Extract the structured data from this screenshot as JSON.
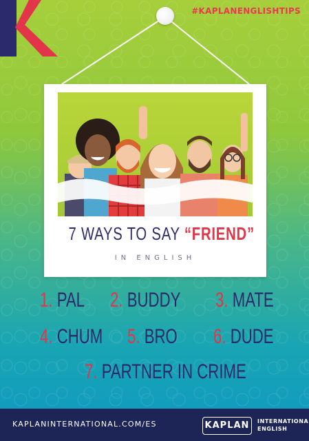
{
  "hashtag": "#KAPLANENGLISHTIPS",
  "title": {
    "prefix": "7 WAYS TO SAY ",
    "highlight": "“FRIEND”",
    "subtitle": "IN ENGLISH"
  },
  "list": [
    {
      "num": "1.",
      "word": "PAL"
    },
    {
      "num": "2.",
      "word": "BUDDY"
    },
    {
      "num": "3.",
      "word": "MATE"
    },
    {
      "num": "4.",
      "word": "CHUM"
    },
    {
      "num": "5.",
      "word": "BRO"
    },
    {
      "num": "6.",
      "word": "DUDE"
    },
    {
      "num": "7.",
      "word": "PARTNER IN CRIME"
    }
  ],
  "footer": {
    "url": "KAPLANINTERNATIONAL.COM/ES",
    "brand": "KAPLAN",
    "brand_sub_1": "INTERNATIONAL",
    "brand_sub_2": "ENGLISH"
  },
  "colors": {
    "accent_red": "#e2354a",
    "navy": "#2c2a6a",
    "footer_bg": "#1d2557"
  },
  "icons": [
    "kaplan-k-logo",
    "pushpin-icon"
  ],
  "illustration": "group-of-friends-selfie"
}
